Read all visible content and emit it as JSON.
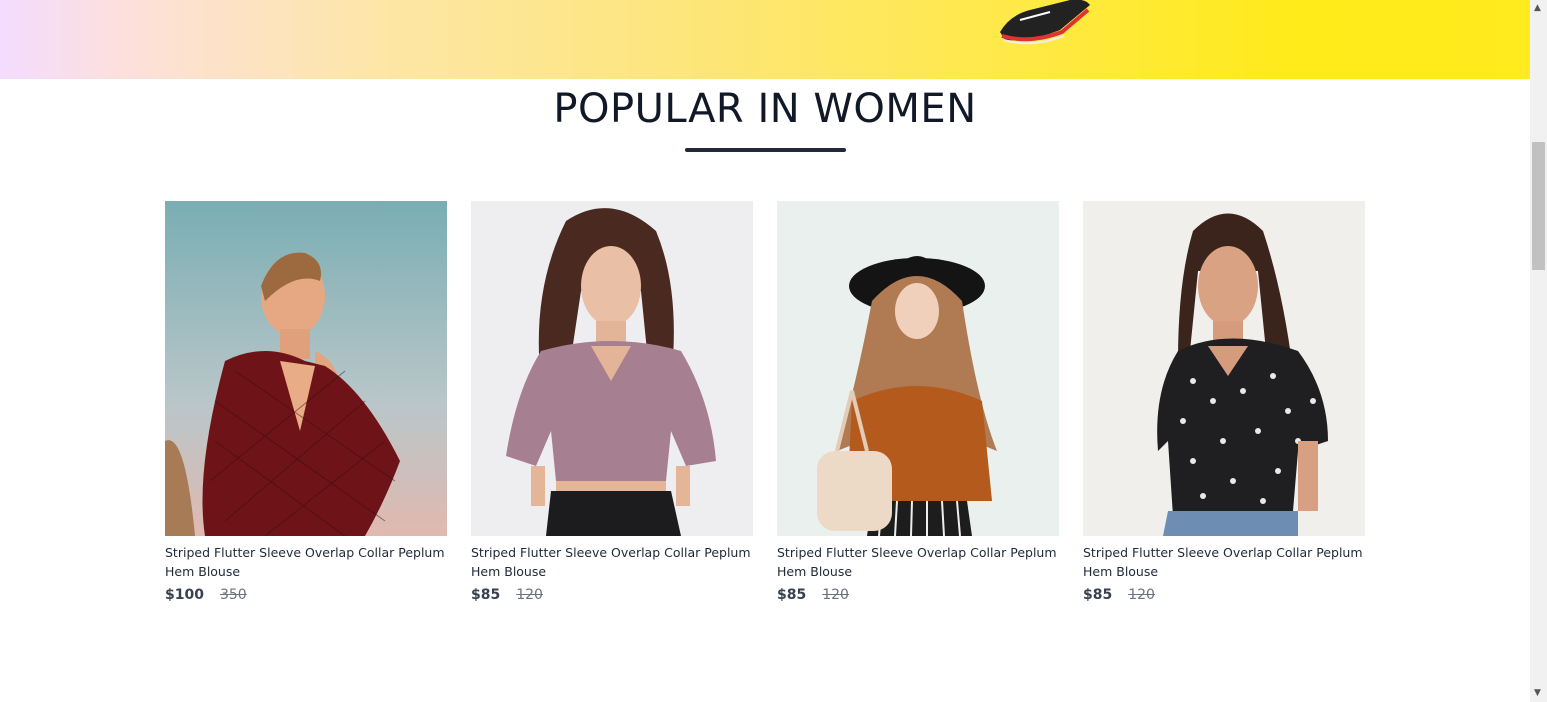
{
  "section": {
    "title": "POPULAR IN WOMEN"
  },
  "products": [
    {
      "name": "Striped Flutter Sleeve Overlap Collar Peplum Hem Blouse",
      "price": "$100",
      "old_price": "350"
    },
    {
      "name": "Striped Flutter Sleeve Overlap Collar Peplum Hem Blouse",
      "price": "$85",
      "old_price": "120"
    },
    {
      "name": "Striped Flutter Sleeve Overlap Collar Peplum Hem Blouse",
      "price": "$85",
      "old_price": "120"
    },
    {
      "name": "Striped Flutter Sleeve Overlap Collar Peplum Hem Blouse",
      "price": "$85",
      "old_price": "120"
    }
  ],
  "colors": {
    "title": "#111827",
    "price": "#374151",
    "old_price": "#6b7280"
  },
  "icons": [
    "shoe-image",
    "scroll-up-arrow-icon",
    "scroll-down-arrow-icon"
  ]
}
